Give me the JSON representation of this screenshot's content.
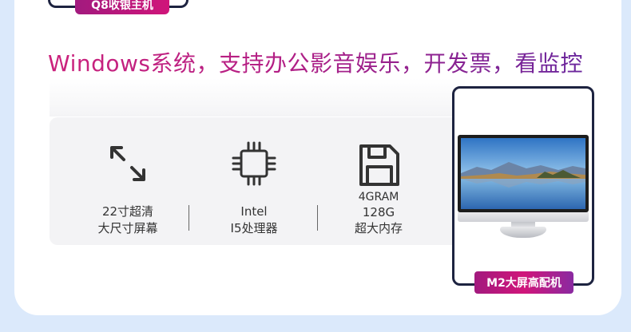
{
  "top_badge": {
    "label": "Q8收银主机"
  },
  "headline": "Windows系统，支持办公影音娱乐，开发票，看监控",
  "specs": [
    {
      "icon": "expand-arrows-icon",
      "lines": [
        "22寸超清",
        "大尺寸屏幕"
      ]
    },
    {
      "icon": "cpu-chip-icon",
      "lines": [
        "Intel",
        "I5处理器"
      ]
    },
    {
      "icon": "floppy-disk-icon",
      "lines": [
        "4GRAM",
        "128G",
        "超大内存"
      ]
    }
  ],
  "product": {
    "label": "M2大屏高配机"
  },
  "colors": {
    "accent_magenta": "#d0157a",
    "accent_purple": "#5e27a0",
    "frame_navy": "#1d2340",
    "page_bg": "#dbe9fb"
  }
}
